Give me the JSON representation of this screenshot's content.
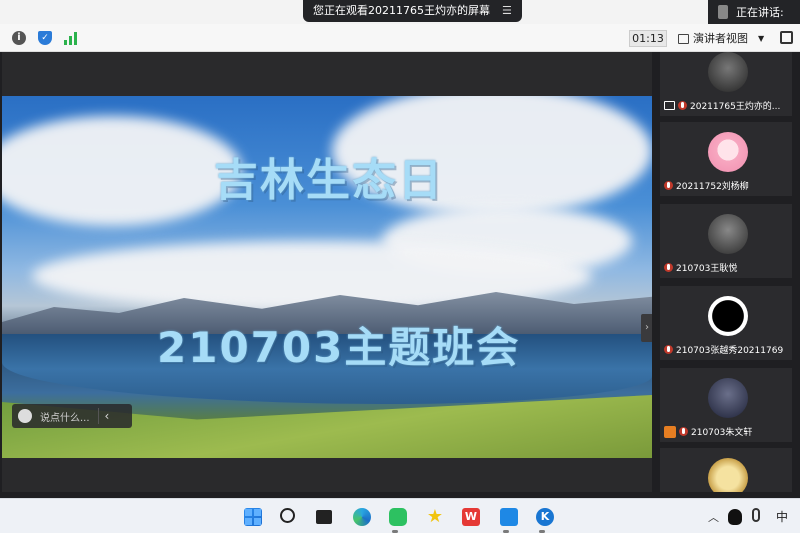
{
  "share_banner": {
    "text": "您正在观看20211765王灼亦的屏幕",
    "menu_icon": "menu-icon"
  },
  "speaking": {
    "label": "正在讲话:"
  },
  "toolbar": {
    "timer": "01:13",
    "view_mode": "演讲者视图",
    "icons": [
      "info-icon",
      "shield-icon",
      "signal-icon",
      "fullscreen-icon"
    ]
  },
  "slide": {
    "title": "吉林生态日",
    "subtitle": "210703主题班会"
  },
  "chat": {
    "placeholder": "说点什么..."
  },
  "participants": [
    {
      "name": "20211765王灼亦的...",
      "sharing": true
    },
    {
      "name": "20211752刘杨柳"
    },
    {
      "name": "210703王耿悦"
    },
    {
      "name": "210703张越秀20211769"
    },
    {
      "name": "210703朱文轩"
    }
  ],
  "taskbar": {
    "ime": "中",
    "apps": [
      "start-icon",
      "search-icon",
      "taskview-icon",
      "edge-icon",
      "wechat-icon",
      "star-icon",
      "wps-icon",
      "cloud-icon",
      "k-icon"
    ],
    "wps_label": "W",
    "k_label": "K"
  }
}
